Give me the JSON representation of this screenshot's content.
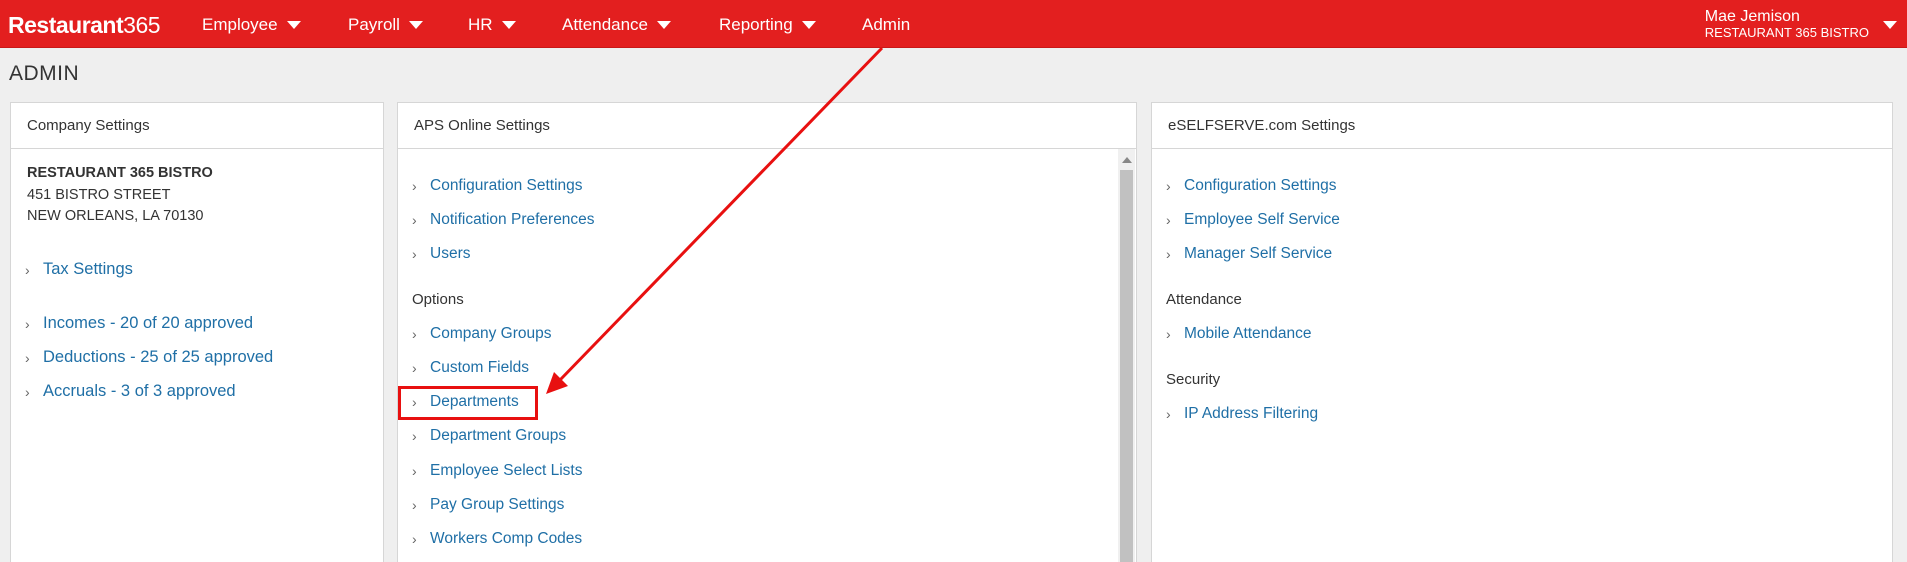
{
  "nav": {
    "logo_bold": "Restaurant",
    "logo_num": "365",
    "items": [
      {
        "label": "Employee"
      },
      {
        "label": "Payroll"
      },
      {
        "label": "HR"
      },
      {
        "label": "Attendance"
      },
      {
        "label": "Reporting"
      },
      {
        "label": "Admin"
      }
    ],
    "user_name": "Mae Jemison",
    "user_company": "RESTAURANT 365 BISTRO"
  },
  "page_title": "ADMIN",
  "company_settings": {
    "title": "Company Settings",
    "name": "RESTAURANT 365 BISTRO",
    "address1": "451 BISTRO STREET",
    "address2": "NEW ORLEANS, LA 70130",
    "links": [
      {
        "label": "Tax Settings"
      },
      {
        "label": "Incomes - 20 of 20 approved"
      },
      {
        "label": "Deductions - 25 of 25 approved"
      },
      {
        "label": "Accruals - 3 of 3 approved"
      }
    ]
  },
  "aps_settings": {
    "title": "APS Online Settings",
    "links_top": [
      {
        "label": "Configuration Settings"
      },
      {
        "label": "Notification Preferences"
      },
      {
        "label": "Users"
      }
    ],
    "options_label": "Options",
    "options": [
      {
        "label": "Company Groups"
      },
      {
        "label": "Custom Fields"
      },
      {
        "label": "Departments"
      },
      {
        "label": "Department Groups"
      },
      {
        "label": "Employee Select Lists"
      },
      {
        "label": "Pay Group Settings"
      },
      {
        "label": "Workers Comp Codes"
      }
    ]
  },
  "ess_settings": {
    "title": "eSELFSERVE.com Settings",
    "links_top": [
      {
        "label": "Configuration Settings"
      },
      {
        "label": "Employee Self Service"
      },
      {
        "label": "Manager Self Service"
      }
    ],
    "attendance_label": "Attendance",
    "attendance_links": [
      {
        "label": "Mobile Attendance"
      }
    ],
    "security_label": "Security",
    "security_links": [
      {
        "label": "IP Address Filtering"
      }
    ]
  },
  "colors": {
    "nav_bg": "#e31f1f",
    "link": "#1f6fa6",
    "annotation": "#e81010"
  },
  "icons": {
    "nav_dropdown": "caret-down-icon",
    "link_bullet": "chevron-right-icon"
  }
}
